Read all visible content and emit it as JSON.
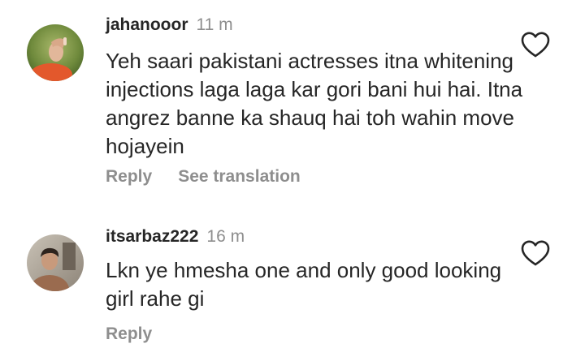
{
  "comments": [
    {
      "username": "jahanooor",
      "time": "11 m",
      "text": "Yeh saari pakistani actresses itna whitening injections laga laga kar gori bani hui hai. Itna angrez banne ka shauq hai toh wahin move hojayein",
      "actions": {
        "reply": "Reply",
        "translate": "See translation"
      },
      "like_icon": "heart-outline-icon",
      "avatar_icon": "avatar-photo"
    },
    {
      "username": "itsarbaz222",
      "time": "16 m",
      "text": "Lkn ye hmesha one and only good looking girl rahe gi",
      "actions": {
        "reply": "Reply"
      },
      "like_icon": "heart-outline-icon",
      "avatar_icon": "avatar-photo"
    }
  ],
  "colors": {
    "primary_text": "#262626",
    "secondary_text": "#8e8e8e",
    "background": "#ffffff"
  }
}
